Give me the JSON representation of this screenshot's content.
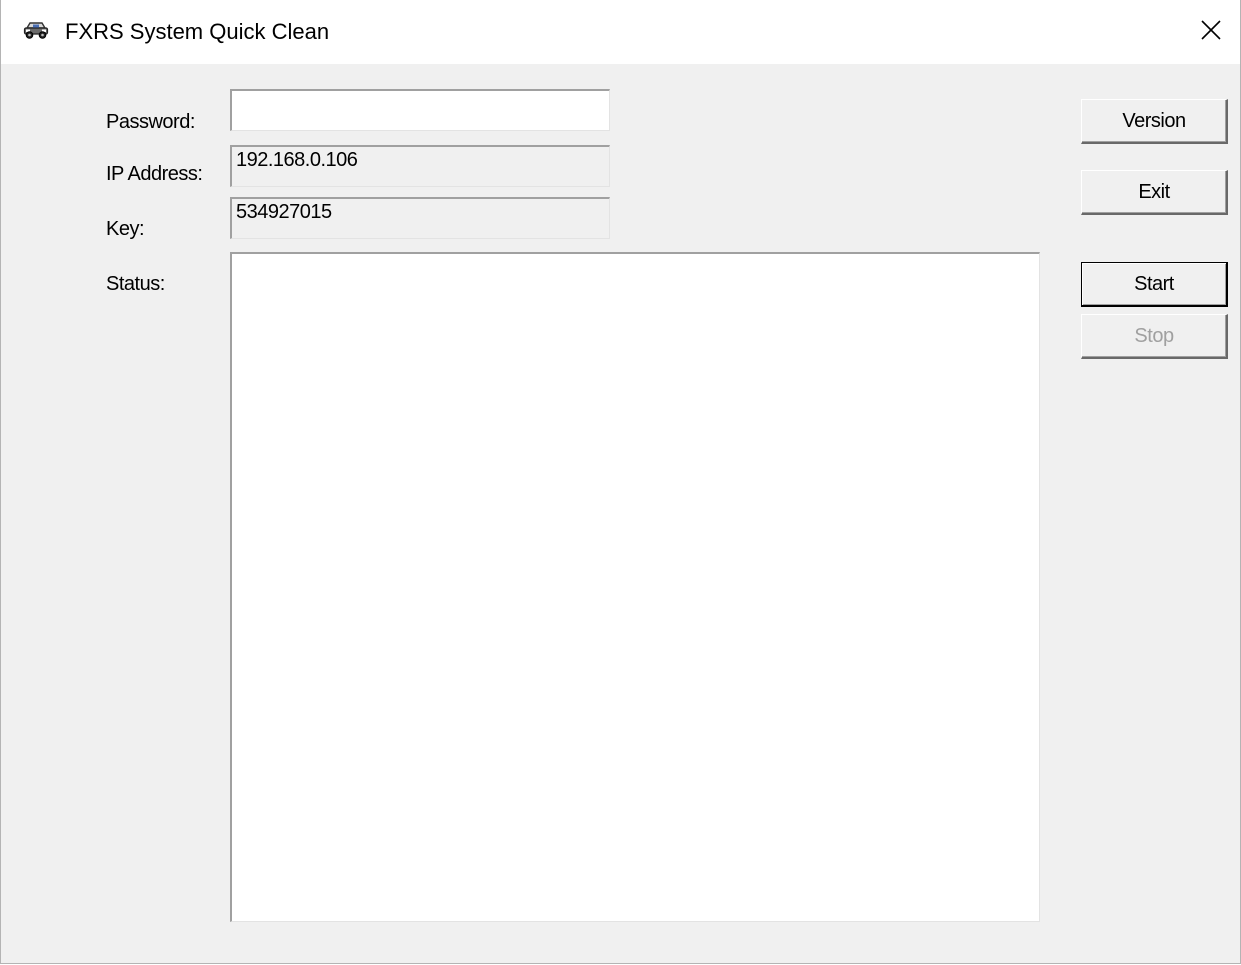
{
  "window": {
    "title": "FXRS System Quick Clean",
    "icon": "car-icon",
    "close_icon": "close-icon"
  },
  "form": {
    "password_label": "Password:",
    "password_value": "",
    "ip_label": "IP Address:",
    "ip_value": "192.168.0.106",
    "key_label": "Key:",
    "key_value": "534927015",
    "status_label": "Status:",
    "status_value": ""
  },
  "buttons": {
    "version": "Version",
    "exit": "Exit",
    "start": "Start",
    "stop": "Stop"
  },
  "colors": {
    "titlebar": "#ffffff",
    "dialog_background": "#f0f0f0",
    "disabled_text": "#a0a0a0"
  }
}
